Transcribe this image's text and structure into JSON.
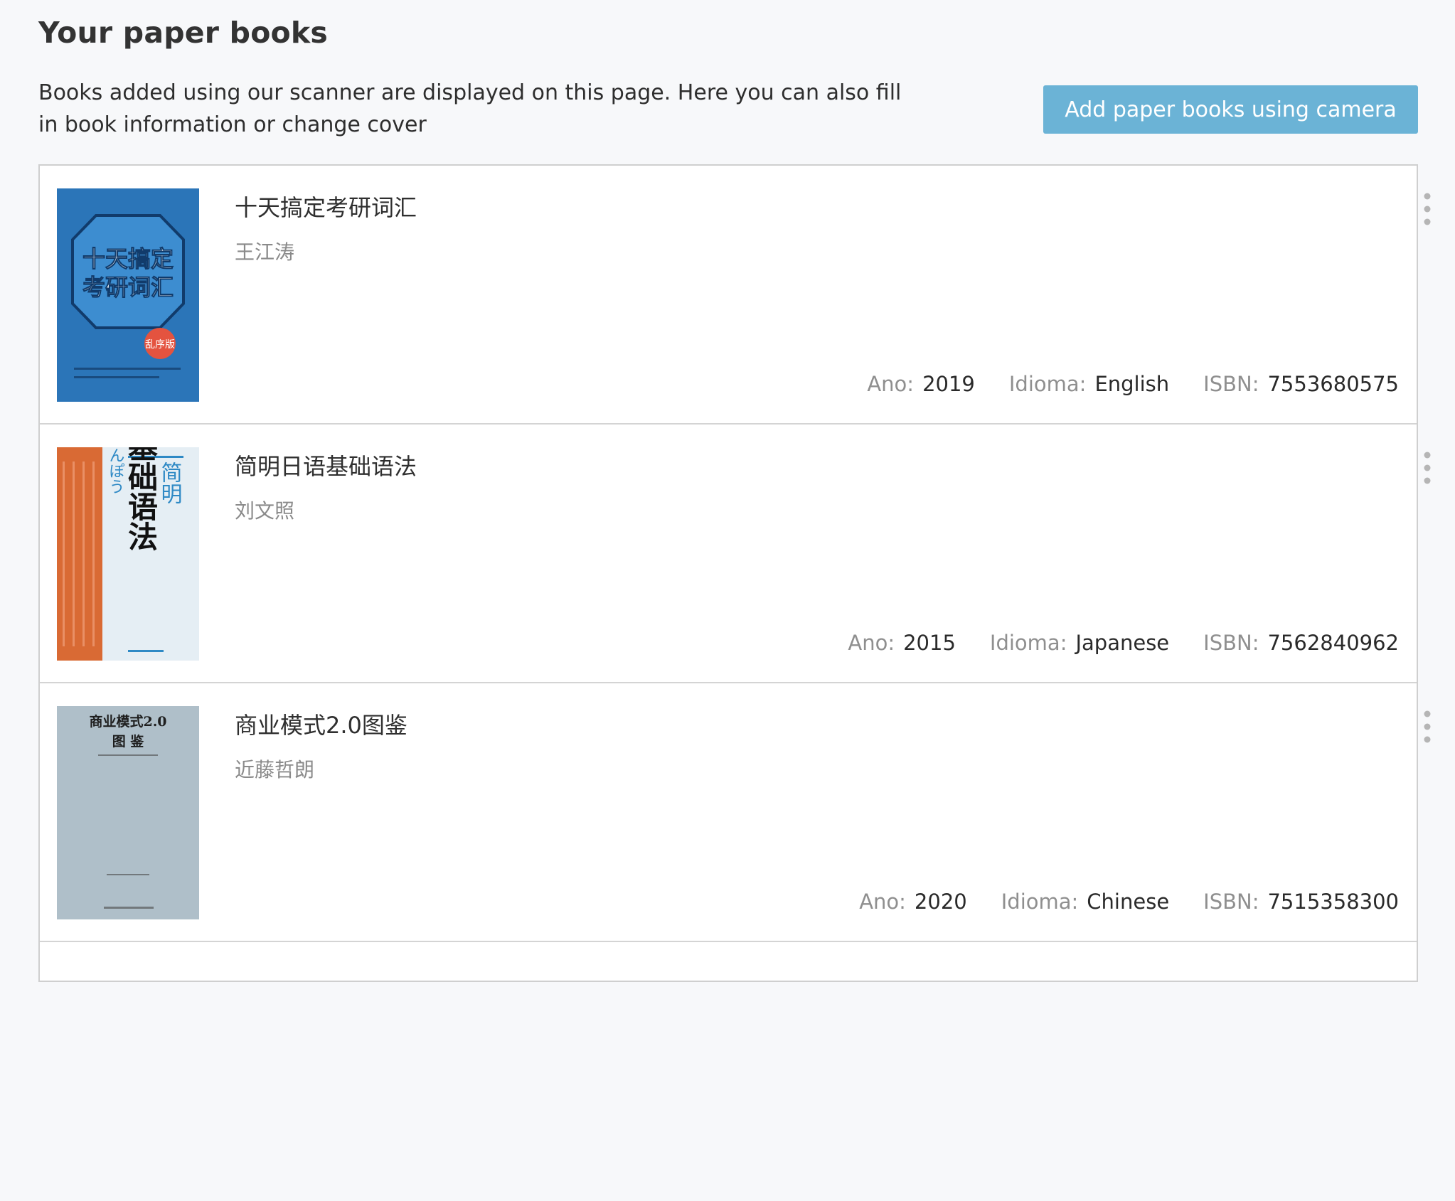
{
  "page": {
    "title": "Your paper books",
    "description": "Books added using our scanner are displayed on this page. Here you can also fill in book information or change cover"
  },
  "toolbar": {
    "add_camera_label": "Add paper books using camera",
    "accent_color": "#6bb3d6"
  },
  "meta_labels": {
    "year": "Ano:",
    "language": "Idioma:",
    "isbn": "ISBN:"
  },
  "books": [
    {
      "title": "十天搞定考研词汇",
      "author": "王江涛",
      "year": "2019",
      "language": "English",
      "isbn": "7553680575",
      "cover": {
        "lines": [
          "十天搞定",
          "考研词汇"
        ],
        "badge": "乱序版",
        "background": "#2f7cc0",
        "accent": "#e4533f"
      }
    },
    {
      "title": "简明日语基础语法",
      "author": "刘文照",
      "year": "2015",
      "language": "Japanese",
      "isbn": "7562840962",
      "cover": {
        "lines": [
          "简明",
          "日语基础语法"
        ],
        "kana": "ふんぽう",
        "background": "#e5eef4",
        "accent": "#d96a34"
      }
    },
    {
      "title": "商业模式2.0图鉴",
      "author": "近藤哲朗",
      "year": "2020",
      "language": "Chinese",
      "isbn": "7515358300",
      "cover": {
        "lines": [
          "商业模式2.0",
          "图 鉴"
        ],
        "background": "#b8c6d0",
        "accent": "#2a2a2a"
      }
    }
  ]
}
